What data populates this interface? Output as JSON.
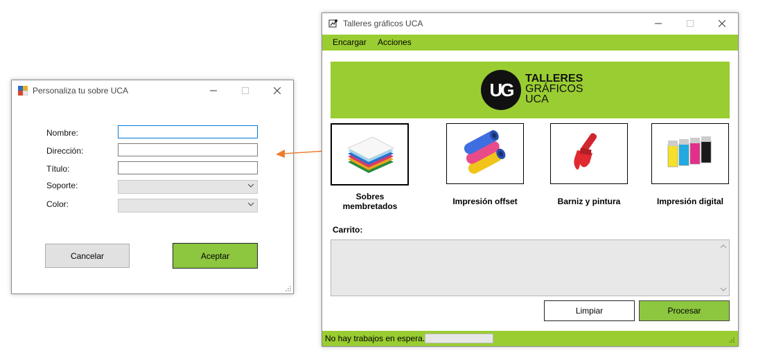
{
  "dialog": {
    "title": "Personaliza tu sobre UCA",
    "fields": {
      "nombre_label": "Nombre:",
      "direccion_label": "Dirección:",
      "titulo_label": "Título:",
      "soporte_label": "Soporte:",
      "color_label": "Color:"
    },
    "values": {
      "nombre": "",
      "direccion": "",
      "titulo": "",
      "soporte": "",
      "color": ""
    },
    "cancel_label": "Cancelar",
    "accept_label": "Aceptar"
  },
  "main": {
    "title": "Talleres gráficos UCA",
    "menu": [
      "Encargar",
      "Acciones"
    ],
    "logo": {
      "monogram": "UG",
      "line1": "TALLERES",
      "line2": "GRÁFICOS",
      "line3": "UCA"
    },
    "products": [
      {
        "label_line1": "Sobres",
        "label_line2": "membretados",
        "icon": "paper-stack-icon"
      },
      {
        "label": "Impresión offset",
        "icon": "offset-rollers-icon"
      },
      {
        "label": "Barniz y pintura",
        "icon": "paint-brush-icon"
      },
      {
        "label": "Impresión digital",
        "icon": "ink-cartridges-icon"
      }
    ],
    "cart_label": "Carrito:",
    "cart_text": "",
    "clear_label": "Limpiar",
    "process_label": "Procesar",
    "status_text": "No hay trabajos en espera."
  },
  "colors": {
    "accent_green": "#9acd32",
    "accept_green": "#8dc63f",
    "arrow_orange": "#ed7d31",
    "logo_black": "#111111"
  }
}
